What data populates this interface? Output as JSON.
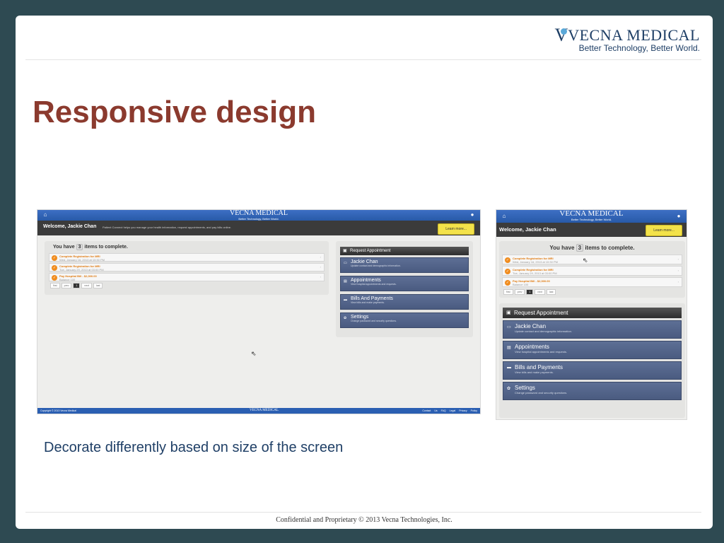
{
  "logo": {
    "name": "VECNA MEDICAL",
    "tagline": "Better Technology, Better World."
  },
  "title": "Responsive design",
  "caption": "Decorate differently based on size of the screen",
  "footer": "Confidential and Proprietary © 2013 Vecna Technologies, Inc.",
  "app": {
    "brand": "VECNA MEDICAL",
    "brand_tag": "Better Technology, Better World.",
    "welcome": "Welcome, Jackie Chan",
    "welcome_sub": "Patient Connect helps you manage your health information, request appointments, and pay bills online.",
    "learn_more": "Learn more...",
    "todo_prefix": "You have",
    "todo_count": "3",
    "todo_suffix": "items to complete.",
    "todos": [
      {
        "title": "Complete Registration for MRI",
        "date": "Wed, January 16, 2013 at 10:30 PM"
      },
      {
        "title": "Complete Registration for MRI",
        "date": "Tue, January 29, 2013 at 03:00 PM"
      },
      {
        "title": "Pay Hospital Bill - $2,000.00",
        "date": "Balance 100"
      }
    ],
    "pager": [
      "first",
      "prev",
      "1",
      "next",
      "last"
    ],
    "menu_head": "Request Appointment",
    "menu": [
      {
        "label": "Jackie Chan",
        "sub": "Update contact and demographic information."
      },
      {
        "label": "Appointments",
        "sub": "View hospital appointments and requests."
      },
      {
        "label": "Bills And Payments",
        "sub": "View bills and make payments."
      },
      {
        "label": "Settings",
        "sub": "Change password and security questions."
      }
    ],
    "menu_mobile_bills": "Bills and Payments",
    "copyright": "Copyright © 2013 Vecna Medical",
    "footer_links": [
      "Contact Us",
      "FAQ",
      "Legal",
      "Privacy Policy"
    ]
  }
}
